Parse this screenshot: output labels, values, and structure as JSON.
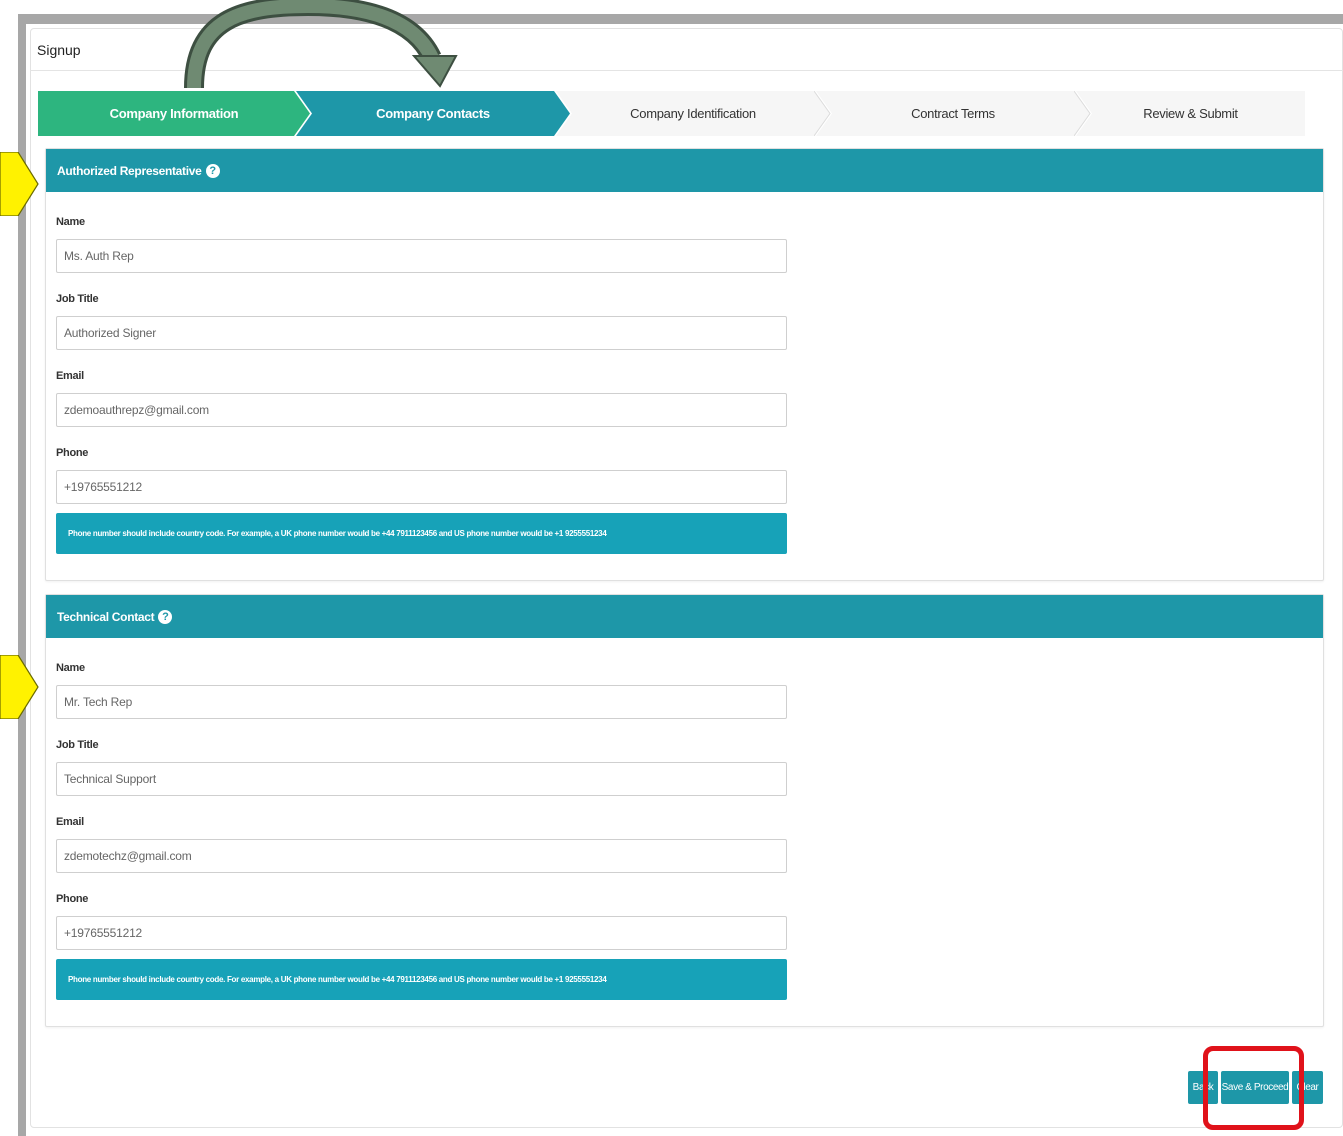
{
  "window": {
    "title": "Signup"
  },
  "steps": [
    {
      "label": "Company Information",
      "state": "done"
    },
    {
      "label": "Company Contacts",
      "state": "active"
    },
    {
      "label": "Company Identification",
      "state": "todo"
    },
    {
      "label": "Contract Terms",
      "state": "todo"
    },
    {
      "label": "Review & Submit",
      "state": "todo"
    }
  ],
  "authorized": {
    "title": "Authorized Representative",
    "name_label": "Name",
    "name_value": "Ms. Auth Rep",
    "job_label": "Job Title",
    "job_value": "Authorized Signer",
    "email_label": "Email",
    "email_value": "zdemoauthrepz@gmail.com",
    "phone_label": "Phone",
    "phone_value": "+19765551212",
    "note": "Phone number should include country code. For example, a UK phone number would be +44 7911123456 and US phone number would be +1 9255551234"
  },
  "technical": {
    "title": "Technical Contact",
    "name_label": "Name",
    "name_value": "Mr. Tech Rep",
    "job_label": "Job Title",
    "job_value": "Technical Support",
    "email_label": "Email",
    "email_value": "zdemotechz@gmail.com",
    "phone_label": "Phone",
    "phone_value": "+19765551212",
    "note": "Phone number should include country code. For example, a UK phone number would be +44 7911123456 and US phone number would be +1 9255551234"
  },
  "buttons": {
    "back": "Back",
    "save": "Save & Proceed",
    "clear": "Clear"
  },
  "colors": {
    "step_done": "#2db57f",
    "accent": "#1e97a8",
    "note_bg": "#17a2b8",
    "highlight_red": "#e0121a",
    "annotation_yellow": "#fff200"
  },
  "icons": {
    "help": "question-circle-icon",
    "annotation_arrow": "curved-arrow-icon",
    "pointer": "yellow-arrow-icon"
  }
}
